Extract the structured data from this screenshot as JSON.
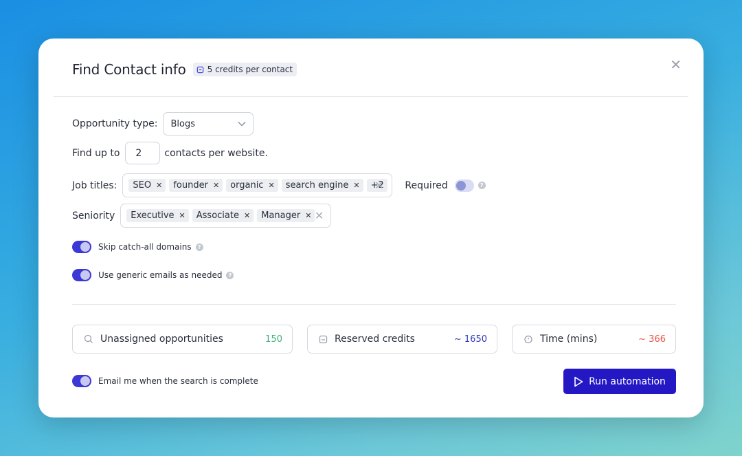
{
  "header": {
    "title": "Find Contact info",
    "credit_badge": "5 credits per contact"
  },
  "opportunity": {
    "label": "Opportunity type:",
    "selected": "Blogs"
  },
  "find_up_to": {
    "prefix": "Find up to",
    "value": "2",
    "suffix": "contacts per website."
  },
  "job_titles": {
    "label": "Job titles:",
    "tags": [
      "SEO",
      "founder",
      "organic",
      "search engine"
    ],
    "more": "+2",
    "required_label": "Required",
    "required_on": false
  },
  "seniority": {
    "label": "Seniority",
    "tags": [
      "Executive",
      "Associate",
      "Manager"
    ]
  },
  "options": {
    "skip_catch_all": "Skip catch-all domains",
    "generic_emails": "Use generic emails as needed",
    "email_me": "Email me when the search is complete"
  },
  "stats": {
    "unassigned": {
      "label": "Unassigned opportunities",
      "value": "150",
      "color": "#3fae7a"
    },
    "reserved": {
      "label": "Reserved credits",
      "value": "~ 1650",
      "color": "#2f37b8"
    },
    "time": {
      "label": "Time (mins)",
      "value": "~ 366",
      "color": "#e8534a"
    }
  },
  "run_button": "Run automation",
  "colors": {
    "accent": "#2318c4",
    "toggle_on": "#3b38d6"
  }
}
